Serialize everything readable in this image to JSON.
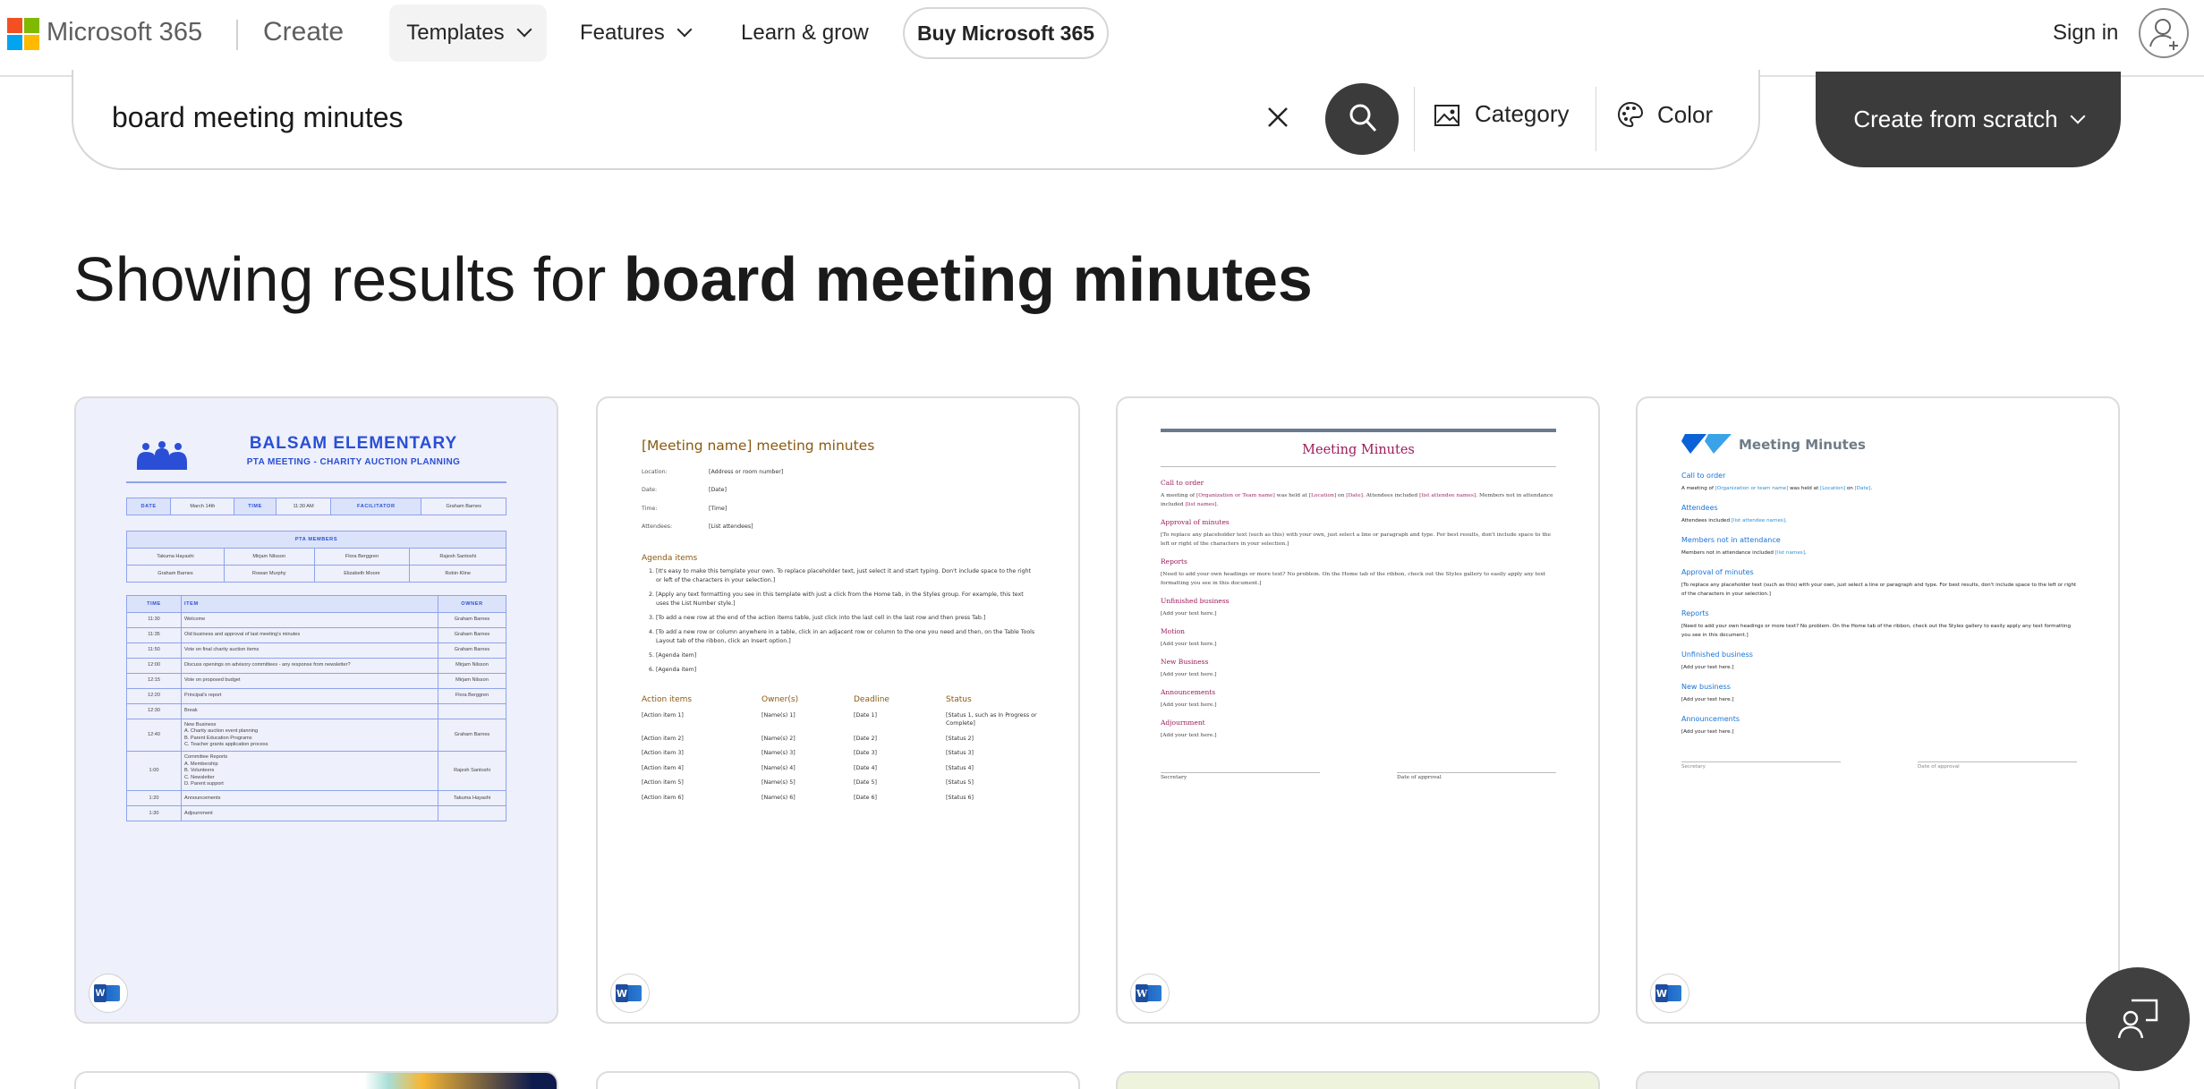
{
  "nav": {
    "brand": "Microsoft 365",
    "section": "Create",
    "items": [
      "Templates",
      "Features",
      "Learn & grow"
    ],
    "buy": "Buy Microsoft 365",
    "sign_in": "Sign in"
  },
  "search": {
    "value": "board meeting minutes",
    "category": "Category",
    "color": "Color",
    "create": "Create from scratch"
  },
  "results": {
    "prefix": "Showing results for ",
    "query": "board meeting minutes"
  },
  "colors": {
    "accent_dark": "#3b3b3b",
    "word_blue": "#185abd"
  },
  "templates": [
    {
      "app": "Word",
      "title": "BALSAM ELEMENTARY",
      "subtitle": "PTA MEETING - CHARITY AUCTION PLANNING",
      "info": [
        "DATE",
        "March 14th",
        "TIME",
        "11:30 AM",
        "FACILITATOR",
        "Graham Barnes"
      ],
      "members_header": "PTA MEMBERS",
      "members": [
        "Takuma Hayashi",
        "Mirjam Nilsson",
        "Flora Berggren",
        "Rajesh Santoshi",
        "Graham Barnes",
        "Rowan Murphy",
        "Elizabeth Moore",
        "Robin Kline"
      ],
      "agenda_headers": [
        "TIME",
        "ITEM",
        "OWNER"
      ],
      "agenda": [
        [
          "11:30",
          "Welcome",
          "Graham Barnes"
        ],
        [
          "11:35",
          "Old business and approval of last meeting's minutes",
          "Graham Barnes"
        ],
        [
          "11:50",
          "Vote on final charity auction items",
          "Graham Barnes"
        ],
        [
          "12:00",
          "Discuss openings on advisory committees - any response from newsletter?",
          "Mirjam Nilsson"
        ],
        [
          "12:15",
          "Vote on proposed budget",
          "Mirjam Nilsson"
        ],
        [
          "12:20",
          "Principal's report",
          "Flora Berggren"
        ],
        [
          "12:30",
          "Break",
          ""
        ],
        [
          "12:40",
          "New Business\nA. Charity auction event planning\nB. Parent Education Programs\nC. Teacher grants application process",
          "Graham Barnes"
        ],
        [
          "1:00",
          "Committee Reports\nA. Membership\nB. Volunteers\nC. Newsletter\nD. Parent support",
          "Rajesh Santoshi"
        ],
        [
          "1:20",
          "Announcements",
          "Takuma Hayashi"
        ],
        [
          "1:30",
          "Adjournment",
          ""
        ]
      ]
    },
    {
      "app": "Word",
      "title": "[Meeting name] meeting minutes",
      "fields": [
        [
          "Location:",
          "[Address or room number]"
        ],
        [
          "Date:",
          "[Date]"
        ],
        [
          "Time:",
          "[Time]"
        ],
        [
          "Attendees:",
          "[List attendees]"
        ]
      ],
      "agenda_heading": "Agenda items",
      "agenda": [
        "[It's easy to make this template your own. To replace placeholder text, just select it and start typing. Don't include space to the right or left of the characters in your selection.]",
        "[Apply any text formatting you see in this template with just a click from the Home tab, in the Styles group. For example, this text uses the List Number style.]",
        "[To add a new row at the end of the action items table, just click into the last cell in the last row and then press Tab.]",
        "[To add a new row or column anywhere in a table, click in an adjacent row or column to the one you need and then, on the Table Tools Layout tab of the ribbon, click an Insert option.]",
        "[Agenda item]",
        "[Agenda item]"
      ],
      "action_headers": [
        "Action items",
        "Owner(s)",
        "Deadline",
        "Status"
      ],
      "actions": [
        [
          "[Action item 1]",
          "[Name(s) 1]",
          "[Date 1]",
          "[Status 1, such as In Progress or Complete]"
        ],
        [
          "[Action item 2]",
          "[Name(s) 2]",
          "[Date 2]",
          "[Status 2]"
        ],
        [
          "[Action item 3]",
          "[Name(s) 3]",
          "[Date 3]",
          "[Status 3]"
        ],
        [
          "[Action item 4]",
          "[Name(s) 4]",
          "[Date 4]",
          "[Status 4]"
        ],
        [
          "[Action item 5]",
          "[Name(s) 5]",
          "[Date 5]",
          "[Status 5]"
        ],
        [
          "[Action item 6]",
          "[Name(s) 6]",
          "[Date 6]",
          "[Status 6]"
        ]
      ]
    },
    {
      "app": "Word",
      "title": "Meeting Minutes",
      "sections": [
        {
          "h": "Call to order",
          "p": [
            [
              "A meeting of ",
              0
            ],
            [
              "[Organization or Team name]",
              1
            ],
            [
              " was held at ",
              0
            ],
            [
              "[Location]",
              1
            ],
            [
              " on ",
              0
            ],
            [
              "[Date]",
              1
            ],
            [
              ". Attendees included ",
              0
            ],
            [
              "[list attendee names]",
              1
            ],
            [
              ". Members not in attendance included ",
              0
            ],
            [
              "[list names]",
              1
            ],
            [
              ".",
              0
            ]
          ]
        },
        {
          "h": "Approval of minutes",
          "p": [
            [
              "[To replace any placeholder text (such as this) with your own, just select a line or paragraph and type. For best results, don't include space to the left or right of the characters in your selection.]",
              0
            ]
          ]
        },
        {
          "h": "Reports",
          "p": [
            [
              "[Need to add your own headings or more text? No problem. On the Home tab of the ribbon, check out the Styles gallery to easily apply any text formatting you see in this document.]",
              0
            ]
          ]
        },
        {
          "h": "Unfinished business",
          "p": [
            [
              "[Add your text here.]",
              0
            ]
          ]
        },
        {
          "h": "Motion",
          "p": [
            [
              "[Add your text here.]",
              0
            ]
          ]
        },
        {
          "h": "New Business",
          "p": [
            [
              "[Add your text here.]",
              0
            ]
          ]
        },
        {
          "h": "Announcements",
          "p": [
            [
              "[Add your text here.]",
              0
            ]
          ]
        },
        {
          "h": "Adjournment",
          "p": [
            [
              "[Add your text here.]",
              0
            ]
          ]
        }
      ],
      "signatures": [
        "Secretary",
        "Date of approval"
      ]
    },
    {
      "app": "Word",
      "title": "Meeting Minutes",
      "sections": [
        {
          "h": "Call to order",
          "p": [
            [
              "A meeting of ",
              0
            ],
            [
              "[Organization or team name]",
              1
            ],
            [
              " was held at ",
              0
            ],
            [
              "[Location]",
              1
            ],
            [
              " on ",
              0
            ],
            [
              "[Date]",
              1
            ],
            [
              ".",
              0
            ]
          ]
        },
        {
          "h": "Attendees",
          "p": [
            [
              "Attendees included ",
              0
            ],
            [
              "[list attendee names]",
              1
            ],
            [
              ".",
              0
            ]
          ]
        },
        {
          "h": "Members not in attendance",
          "p": [
            [
              "Members not in attendance included ",
              0
            ],
            [
              "[list names]",
              1
            ],
            [
              ".",
              0
            ]
          ]
        },
        {
          "h": "Approval of minutes",
          "p": [
            [
              "[To replace any placeholder text (such as this) with your own, just select a line or paragraph and type. For best results, don't include space to the left or right of the characters in your selection.]",
              0
            ]
          ]
        },
        {
          "h": "Reports",
          "p": [
            [
              "[Need to add your own headings or more text? No problem. On the Home tab of the ribbon, check out the Styles gallery to easily apply any text formatting you see in this document.]",
              0
            ]
          ]
        },
        {
          "h": "Unfinished business",
          "p": [
            [
              "[Add your text here.]",
              0
            ]
          ]
        },
        {
          "h": "New business",
          "p": [
            [
              "[Add your text here.]",
              0
            ]
          ]
        },
        {
          "h": "Announcements",
          "p": [
            [
              "[Add your text here.]",
              0
            ]
          ]
        }
      ],
      "signatures": [
        "Secretary",
        "Date of approval"
      ]
    }
  ]
}
